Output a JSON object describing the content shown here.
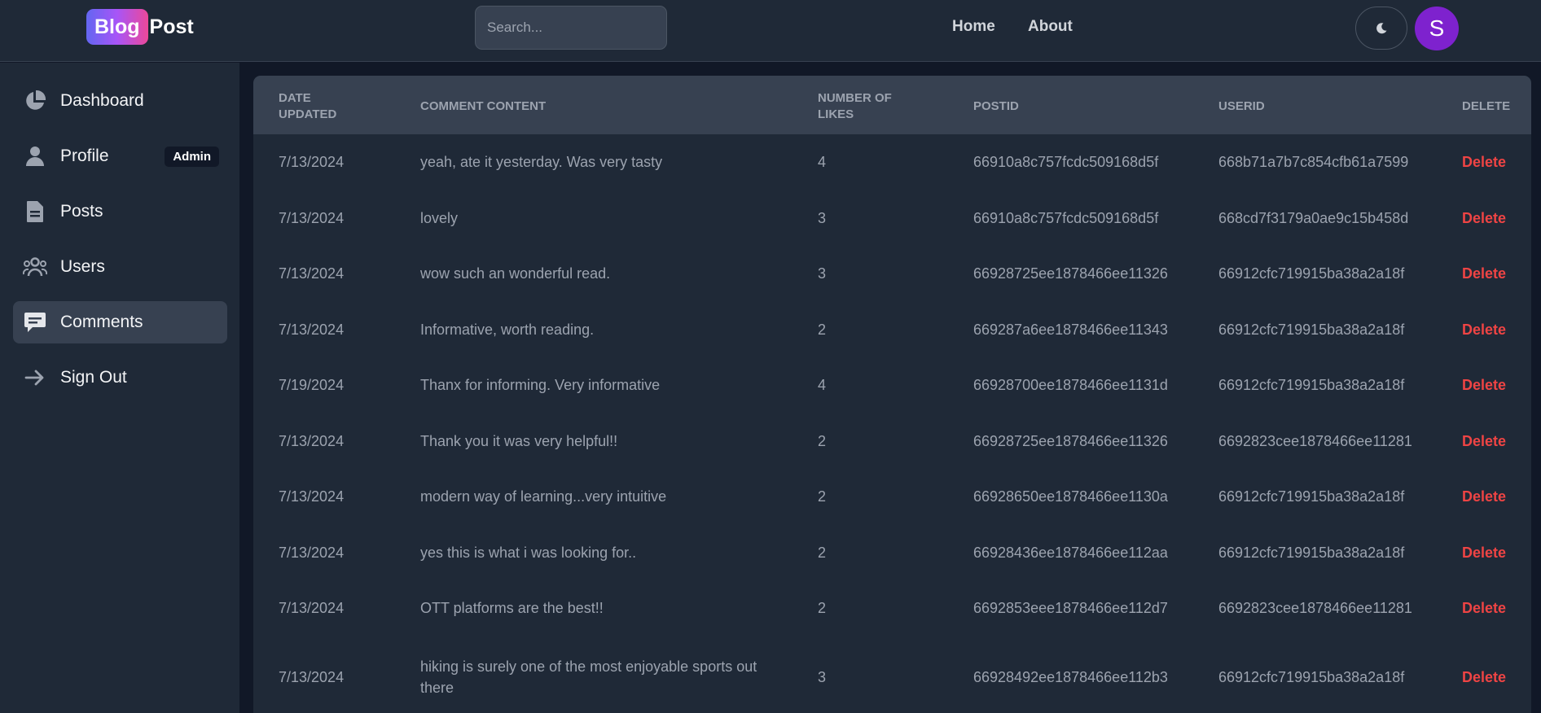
{
  "header": {
    "logo_badge": "Blog",
    "logo_text": "Post",
    "search_placeholder": "Search...",
    "nav": {
      "home": "Home",
      "about": "About"
    },
    "avatar_initial": "S"
  },
  "sidebar": {
    "items": [
      {
        "label": "Dashboard",
        "icon": "pie-chart-icon"
      },
      {
        "label": "Profile",
        "icon": "user-icon",
        "badge": "Admin"
      },
      {
        "label": "Posts",
        "icon": "document-icon"
      },
      {
        "label": "Users",
        "icon": "users-icon"
      },
      {
        "label": "Comments",
        "icon": "comment-icon",
        "active": true
      },
      {
        "label": "Sign Out",
        "icon": "arrow-right-icon"
      }
    ]
  },
  "table": {
    "headers": {
      "date_line1": "Date",
      "date_line2": "Updated",
      "content": "Comment content",
      "likes_line1": "Number of",
      "likes_line2": "Likes",
      "postid": "PostId",
      "userid": "UserId",
      "delete": "Delete"
    },
    "rows": [
      {
        "date": "7/13/2024",
        "content": "yeah, ate it yesterday. Was very tasty",
        "likes": "4",
        "postid": "66910a8c757fcdc509168d5f",
        "userid": "668b71a7b7c854cfb61a7599",
        "action": "Delete"
      },
      {
        "date": "7/13/2024",
        "content": "lovely",
        "likes": "3",
        "postid": "66910a8c757fcdc509168d5f",
        "userid": "668cd7f3179a0ae9c15b458d",
        "action": "Delete"
      },
      {
        "date": "7/13/2024",
        "content": "wow such an wonderful read.",
        "likes": "3",
        "postid": "66928725ee1878466ee11326",
        "userid": "66912cfc719915ba38a2a18f",
        "action": "Delete"
      },
      {
        "date": "7/13/2024",
        "content": "Informative, worth reading.",
        "likes": "2",
        "postid": "669287a6ee1878466ee11343",
        "userid": "66912cfc719915ba38a2a18f",
        "action": "Delete"
      },
      {
        "date": "7/19/2024",
        "content": "Thanx for informing. Very informative",
        "likes": "4",
        "postid": "66928700ee1878466ee1131d",
        "userid": "66912cfc719915ba38a2a18f",
        "action": "Delete"
      },
      {
        "date": "7/13/2024",
        "content": "Thank you it was very helpful!!",
        "likes": "2",
        "postid": "66928725ee1878466ee11326",
        "userid": "6692823cee1878466ee11281",
        "action": "Delete"
      },
      {
        "date": "7/13/2024",
        "content": "modern way of learning...very intuitive",
        "likes": "2",
        "postid": "66928650ee1878466ee1130a",
        "userid": "66912cfc719915ba38a2a18f",
        "action": "Delete"
      },
      {
        "date": "7/13/2024",
        "content": "yes this is what i was looking for..",
        "likes": "2",
        "postid": "66928436ee1878466ee112aa",
        "userid": "66912cfc719915ba38a2a18f",
        "action": "Delete"
      },
      {
        "date": "7/13/2024",
        "content": "OTT platforms are the best!!",
        "likes": "2",
        "postid": "6692853eee1878466ee112d7",
        "userid": "6692823cee1878466ee11281",
        "action": "Delete"
      },
      {
        "date": "7/13/2024",
        "content": "hiking is surely one of the most enjoyable sports out there",
        "likes": "3",
        "postid": "66928492ee1878466ee112b3",
        "userid": "66912cfc719915ba38a2a18f",
        "action": "Delete"
      }
    ]
  },
  "colors": {
    "background": "#111827",
    "panel": "#1f2937",
    "header_row": "#374151",
    "delete": "#ef4444",
    "avatar": "#7e22ce"
  }
}
